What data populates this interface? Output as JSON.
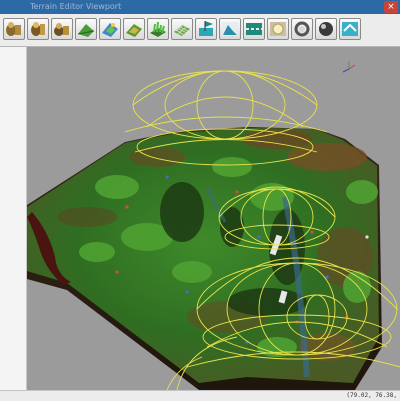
{
  "window": {
    "title": "Terrain Editor Viewport"
  },
  "toolbar": {
    "tools": [
      {
        "name": "unit-placer-a-icon"
      },
      {
        "name": "unit-placer-b-icon"
      },
      {
        "name": "unit-placer-c-icon"
      },
      {
        "name": "terrain-raise-icon"
      },
      {
        "name": "terrain-paint-icon"
      },
      {
        "name": "terrain-smooth-icon"
      },
      {
        "name": "grass-tile-icon"
      },
      {
        "name": "terrain-grid-icon"
      },
      {
        "name": "water-flag-icon"
      },
      {
        "name": "cliff-icon"
      },
      {
        "name": "road-icon"
      },
      {
        "name": "light-sun-icon"
      },
      {
        "name": "ring-icon"
      },
      {
        "name": "sphere-icon"
      },
      {
        "name": "tile-swap-icon"
      }
    ]
  },
  "status": {
    "coords": "(79.02, 76.38,"
  }
}
